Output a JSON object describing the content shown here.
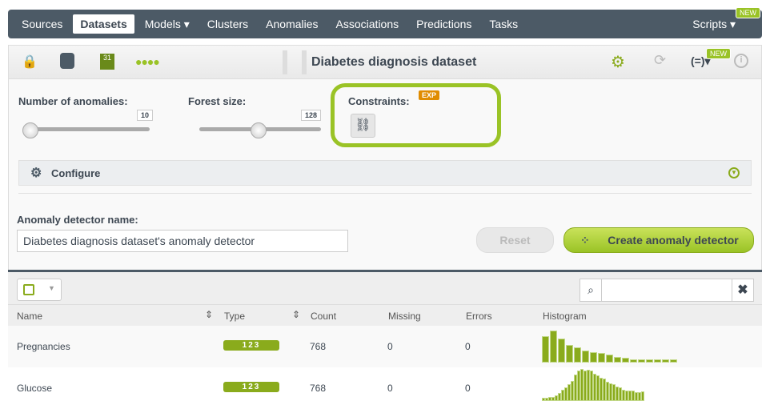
{
  "nav": {
    "items": [
      "Sources",
      "Datasets",
      "Models ▾",
      "Clusters",
      "Anomalies",
      "Associations",
      "Predictions",
      "Tasks"
    ],
    "active": "Datasets",
    "scripts": "Scripts ▾",
    "new_badge": "NEW"
  },
  "toolbar": {
    "title": "Diabetes diagnosis dataset",
    "new_badge": "NEW",
    "icons": [
      "lock-icon",
      "dataset-search-icon",
      "fields-icon",
      "dots-icon",
      "settings-icon",
      "sync-icon",
      "formula-icon",
      "info-icon"
    ]
  },
  "form": {
    "anomalies_label": "Number of anomalies:",
    "anomalies_value": "10",
    "anomalies_fraction": 0.0,
    "forest_label": "Forest size:",
    "forest_value": "128",
    "forest_fraction": 0.5,
    "constraints_label": "Constraints:",
    "exp_badge": "EXP",
    "configure": "Configure",
    "name_label": "Anomaly detector name:",
    "name_value": "Diabetes diagnosis dataset's anomaly detector",
    "reset": "Reset",
    "create": "Create anomaly detector"
  },
  "table": {
    "headers": [
      "Name",
      "Type",
      "Count",
      "Missing",
      "Errors",
      "Histogram"
    ],
    "rows": [
      {
        "name": "Pregnancies",
        "type": "123",
        "count": "768",
        "missing": "0",
        "errors": "0",
        "hist": [
          32,
          39,
          29,
          21,
          19,
          15,
          13,
          12,
          10,
          7,
          6,
          4,
          4,
          4,
          4,
          4,
          4
        ]
      },
      {
        "name": "Glucose",
        "type": "123",
        "count": "768",
        "missing": "0",
        "errors": "0",
        "hist": [
          4,
          4,
          5,
          5,
          7,
          10,
          14,
          17,
          21,
          25,
          33,
          38,
          40,
          38,
          39,
          38,
          34,
          32,
          29,
          28,
          24,
          22,
          21,
          18,
          17,
          14,
          13,
          13,
          13,
          11,
          11,
          12
        ]
      }
    ]
  },
  "colors": {
    "accent": "#9ac326",
    "nav": "#4c5a66"
  }
}
